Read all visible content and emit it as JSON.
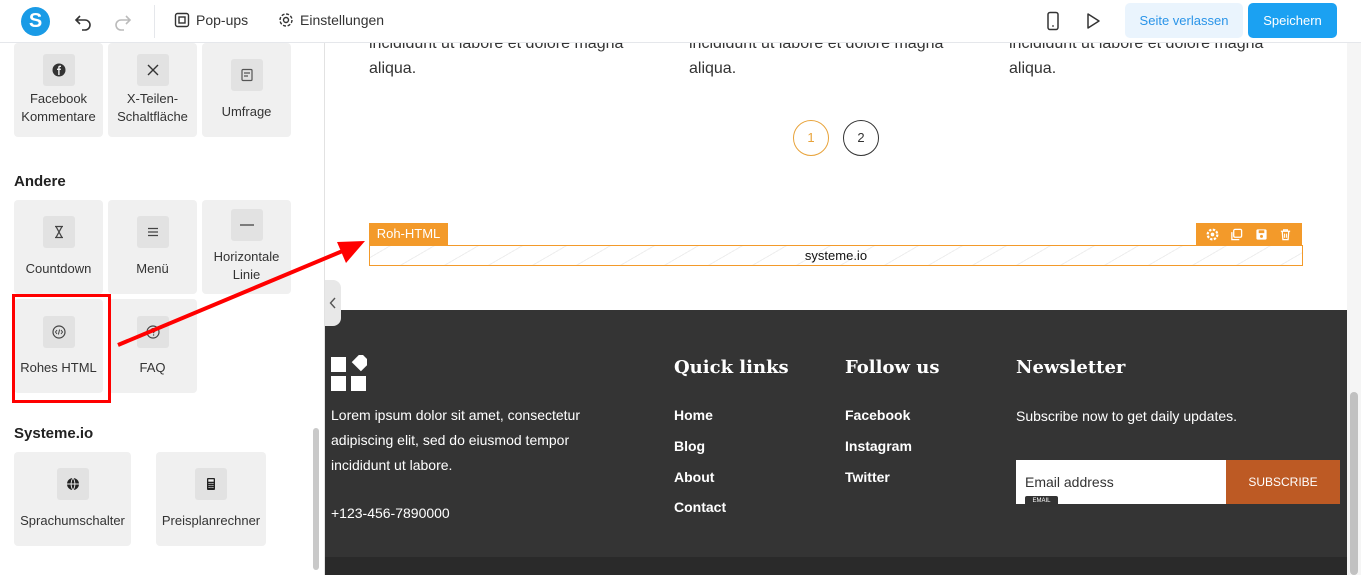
{
  "toolbar": {
    "popups_label": "Pop-ups",
    "settings_label": "Einstellungen",
    "leave_label": "Seite verlassen",
    "save_label": "Speichern"
  },
  "sidebar": {
    "top_tiles": [
      "Facebook Kommentare",
      "X-Teilen-Schaltfläche",
      "Umfrage"
    ],
    "sections": [
      {
        "title": "Andere",
        "tiles": [
          "Countdown",
          "Menü",
          "Horizontale Linie",
          "Rohes HTML",
          "FAQ"
        ]
      },
      {
        "title": "Systeme.io",
        "tiles": [
          "Sprachumschalter",
          "Preisplanrechner"
        ]
      }
    ]
  },
  "canvas": {
    "col_text": [
      "incididunt ut labore et dolore magna aliqua.",
      "incididunt ut labore et dolore magna aliqua.",
      "incididunt ut labore et dolore magna aliqua."
    ],
    "pagination": [
      "1",
      "2"
    ],
    "raw_html": {
      "tag": "Roh-HTML",
      "content": "systeme.io"
    },
    "footer": {
      "description": "Lorem ipsum dolor sit amet, consectetur adipiscing elit, sed do eiusmod tempor incididunt ut labore.",
      "phone": "+123-456-7890000",
      "quick_links": {
        "title": "Quick links",
        "items": [
          "Home",
          "Blog",
          "About",
          "Contact"
        ]
      },
      "follow": {
        "title": "Follow us",
        "items": [
          "Facebook",
          "Instagram",
          "Twitter"
        ]
      },
      "newsletter": {
        "title": "Newsletter",
        "text": "Subscribe now to get daily updates.",
        "placeholder": "Email address",
        "badge": "EMAIL",
        "button": "SUBSCRIBE"
      }
    }
  },
  "colors": {
    "accent": "#1ba1f2",
    "orange": "#f39a2a",
    "footer_bg": "#343434",
    "subscribe": "#bd5a24",
    "annotation": "#ff0000"
  }
}
